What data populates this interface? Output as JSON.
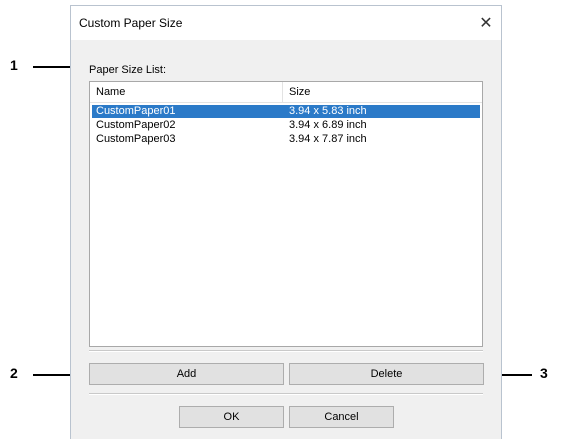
{
  "dialog": {
    "title": "Custom Paper Size",
    "close_label": "✕",
    "list_label": "Paper Size List:",
    "columns": [
      "Name",
      "Size"
    ],
    "rows": [
      {
        "name": "CustomPaper01",
        "size": "3.94 x 5.83 inch",
        "selected": true
      },
      {
        "name": "CustomPaper02",
        "size": "3.94 x 6.89 inch",
        "selected": false
      },
      {
        "name": "CustomPaper03",
        "size": "3.94 x 7.87 inch",
        "selected": false
      }
    ],
    "buttons": {
      "add": "Add",
      "delete": "Delete",
      "ok": "OK",
      "cancel": "Cancel"
    }
  },
  "callouts": [
    "1",
    "2",
    "3"
  ],
  "colors": {
    "selection": "#2b7ac8",
    "dialog_bg": "#f0f0f0"
  }
}
